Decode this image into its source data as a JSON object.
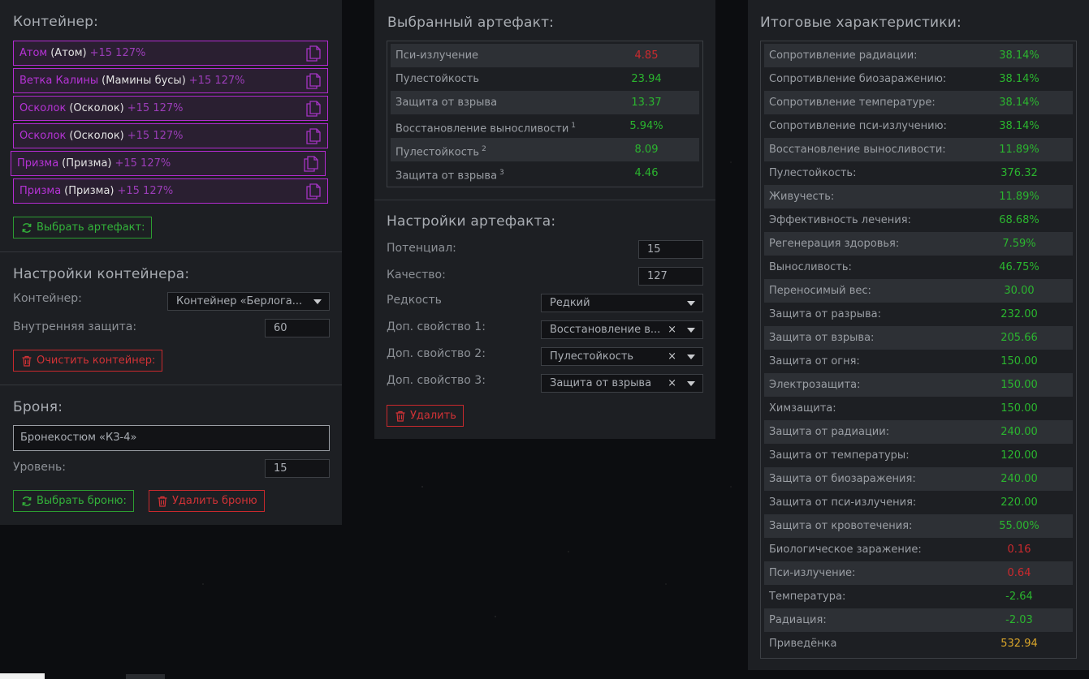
{
  "container_section": {
    "title": "Контейнер:",
    "slots": [
      {
        "name": "Атом",
        "real": "(Атом)",
        "level": "+15 127%"
      },
      {
        "name": "Ветка Калины",
        "real": "(Мамины бусы)",
        "level": "+15 127%"
      },
      {
        "name": "Осколок",
        "real": "(Осколок)",
        "level": "+15 127%"
      },
      {
        "name": "Осколок",
        "real": "(Осколок)",
        "level": "+15 127%"
      },
      {
        "name": "Призма",
        "real": "(Призма)",
        "level": "+15 127%"
      },
      {
        "name": "Призма",
        "real": "(Призма)",
        "level": "+15 127%"
      }
    ],
    "select_artifact_label": "Выбрать артефакт:"
  },
  "container_settings": {
    "title": "Настройки контейнера:",
    "container_label": "Контейнер:",
    "container_value": "Контейнер «Берлога...",
    "inner_protection_label": "Внутренняя защита:",
    "inner_protection_value": "60",
    "clear_label": "Очистить контейнер:"
  },
  "armor": {
    "title": "Броня:",
    "value": "Бронекостюм «КЗ-4»",
    "level_label": "Уровень:",
    "level_value": "15",
    "select_label": "Выбрать броню:",
    "delete_label": "Удалить броню"
  },
  "selected_artifact": {
    "title": "Выбранный артефакт:",
    "stats": [
      {
        "name": "Пси-излучение",
        "sup": "",
        "value": "4.85",
        "tone": "neg"
      },
      {
        "name": "Пулестойкость",
        "sup": "",
        "value": "23.94",
        "tone": "pos"
      },
      {
        "name": "Защита от взрыва",
        "sup": "",
        "value": "13.37",
        "tone": "pos"
      },
      {
        "name": "Восстановление выносливости",
        "sup": "1",
        "value": "5.94%",
        "tone": "pos"
      },
      {
        "name": "Пулестойкость",
        "sup": "2",
        "value": "8.09",
        "tone": "pos"
      },
      {
        "name": "Защита от взрыва",
        "sup": "3",
        "value": "4.46",
        "tone": "pos"
      }
    ]
  },
  "artifact_settings": {
    "title": "Настройки артефакта:",
    "potential_label": "Потенциал:",
    "potential_value": "15",
    "quality_label": "Качество:",
    "quality_value": "127",
    "rarity_label": "Редкость",
    "rarity_value": "Редкий",
    "prop1_label": "Доп. свойство 1:",
    "prop1_value": "Восстановление в...",
    "prop2_label": "Доп. свойство 2:",
    "prop2_value": "Пулестойкость",
    "prop3_label": "Доп. свойство 3:",
    "prop3_value": "Защита от взрыва",
    "clear_glyph": "×",
    "delete_label": "Удалить"
  },
  "totals": {
    "title": "Итоговые характеристики:",
    "stats": [
      {
        "name": "Сопротивление радиации:",
        "value": "38.14%",
        "tone": "pos"
      },
      {
        "name": "Сопротивление биозаражению:",
        "value": "38.14%",
        "tone": "pos"
      },
      {
        "name": "Сопротивление температуре:",
        "value": "38.14%",
        "tone": "pos"
      },
      {
        "name": "Сопротивление пси-излучению:",
        "value": "38.14%",
        "tone": "pos"
      },
      {
        "name": "Восстановление выносливости:",
        "value": "11.89%",
        "tone": "pos"
      },
      {
        "name": "Пулестойкость:",
        "value": "376.32",
        "tone": "pos"
      },
      {
        "name": "Живучесть:",
        "value": "11.89%",
        "tone": "pos"
      },
      {
        "name": "Эффективность лечения:",
        "value": "68.68%",
        "tone": "pos"
      },
      {
        "name": "Регенерация здоровья:",
        "value": "7.59%",
        "tone": "pos"
      },
      {
        "name": "Выносливость:",
        "value": "46.75%",
        "tone": "pos"
      },
      {
        "name": "Переносимый вес:",
        "value": "30.00",
        "tone": "pos"
      },
      {
        "name": "Защита от разрыва:",
        "value": "232.00",
        "tone": "pos"
      },
      {
        "name": "Защита от взрыва:",
        "value": "205.66",
        "tone": "pos"
      },
      {
        "name": "Защита от огня:",
        "value": "150.00",
        "tone": "pos"
      },
      {
        "name": "Электрозащита:",
        "value": "150.00",
        "tone": "pos"
      },
      {
        "name": "Химзащита:",
        "value": "150.00",
        "tone": "pos"
      },
      {
        "name": "Защита от радиации:",
        "value": "240.00",
        "tone": "pos"
      },
      {
        "name": "Защита от температуры:",
        "value": "120.00",
        "tone": "pos"
      },
      {
        "name": "Защита от биозаражения:",
        "value": "240.00",
        "tone": "pos"
      },
      {
        "name": "Защита от пси-излучения:",
        "value": "220.00",
        "tone": "pos"
      },
      {
        "name": "Защита от кровотечения:",
        "value": "55.00%",
        "tone": "pos"
      },
      {
        "name": "Биологическое заражение:",
        "value": "0.16",
        "tone": "neg"
      },
      {
        "name": "Пси-излучение:",
        "value": "0.64",
        "tone": "neg"
      },
      {
        "name": "Температура:",
        "value": "-2.64",
        "tone": "pos"
      },
      {
        "name": "Радиация:",
        "value": "-2.03",
        "tone": "pos"
      },
      {
        "name": "Приведёнка",
        "value": "532.94",
        "tone": "gold"
      }
    ]
  },
  "colors": {
    "accent_purple": "#b42bd1",
    "positive": "#2bb52f",
    "negative": "#cc2a2e",
    "gold": "#d9a52a"
  },
  "icons": {
    "slot_icon": "document-icon",
    "select_icon": "refresh-icon",
    "delete_icon": "trash-icon"
  }
}
